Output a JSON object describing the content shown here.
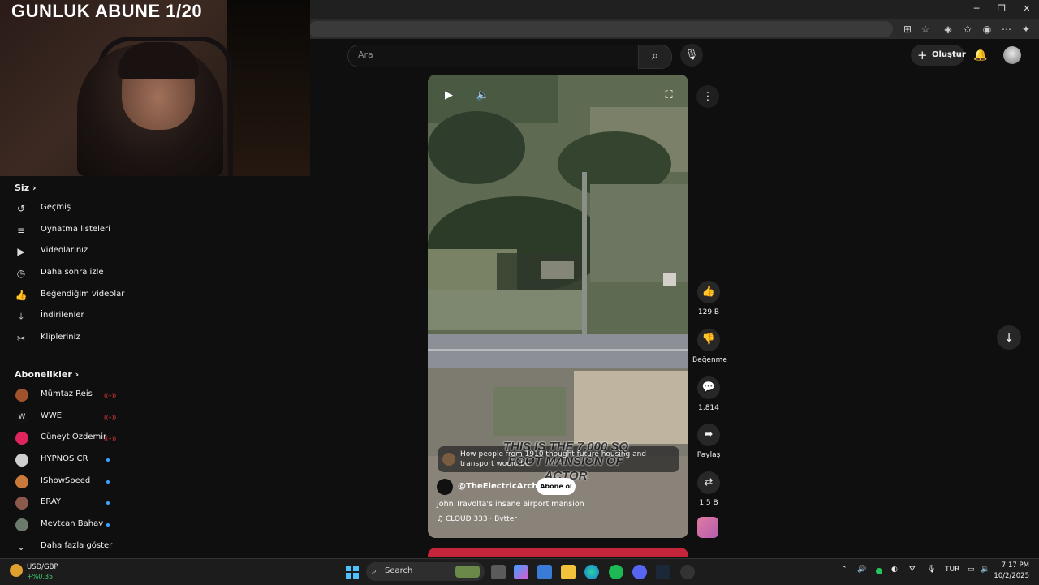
{
  "overlay": {
    "title": "GUNLUK ABUNE 1/20"
  },
  "header": {
    "search_placeholder": "Ara",
    "create_label": "Oluştur"
  },
  "sidebar": {
    "you_header": "Siz",
    "you_items": [
      {
        "label": "Geçmiş",
        "icon": "history-icon"
      },
      {
        "label": "Oynatma listeleri",
        "icon": "playlist-icon"
      },
      {
        "label": "Videolarınız",
        "icon": "your-videos-icon"
      },
      {
        "label": "Daha sonra izle",
        "icon": "watch-later-icon"
      },
      {
        "label": "Beğendiğim videolar",
        "icon": "liked-icon"
      },
      {
        "label": "İndirilenler",
        "icon": "download-icon"
      },
      {
        "label": "Klipleriniz",
        "icon": "scissors-icon"
      }
    ],
    "subs_header": "Abonelikler",
    "subs": [
      {
        "name": "Mümtaz Reis",
        "status": "live",
        "color": "#a0522d"
      },
      {
        "name": "WWE",
        "status": "live",
        "color": "#111111"
      },
      {
        "name": "Cüneyt Özdemir",
        "status": "live",
        "color": "#e0245e"
      },
      {
        "name": "HYPNOS CR",
        "status": "new",
        "color": "#cfcfcf"
      },
      {
        "name": "IShowSpeed",
        "status": "new",
        "color": "#c97a3a"
      },
      {
        "name": "ERAY",
        "status": "new",
        "color": "#8b5a4a"
      },
      {
        "name": "Mevtcan Bahav",
        "status": "new",
        "color": "#6b7a6b"
      }
    ],
    "show_more": "Daha fazla göster"
  },
  "video": {
    "meta_text": "How people from 1910 thought future housing and transport would be",
    "caption_line1": "THIS IS THE 7,000 SQ",
    "caption_line2": "FOOT MANSION OF",
    "caption_line3": "ACTOR",
    "channel": "@TheElectricArchives",
    "subscribe_label": "Abone ol",
    "title": "John Travolta's insane airport mansion",
    "music": "CLOUD 333 · Bvtter"
  },
  "actions": {
    "likes": "129 B",
    "dislike_label": "Beğenme",
    "comments": "1.814",
    "share_label": "Paylaş",
    "remix": "1,5 B"
  },
  "taskbar": {
    "ticker_symbol": "USD/GBP",
    "ticker_change": "+%0,35",
    "search_label": "Search",
    "language": "TUR",
    "time": "7:17 PM",
    "date": "10/2/2025"
  },
  "colors": {
    "accent_red": "#ff3d3d",
    "new_dot": "#3ea6ff",
    "ticker_green": "#3ccf6e"
  }
}
